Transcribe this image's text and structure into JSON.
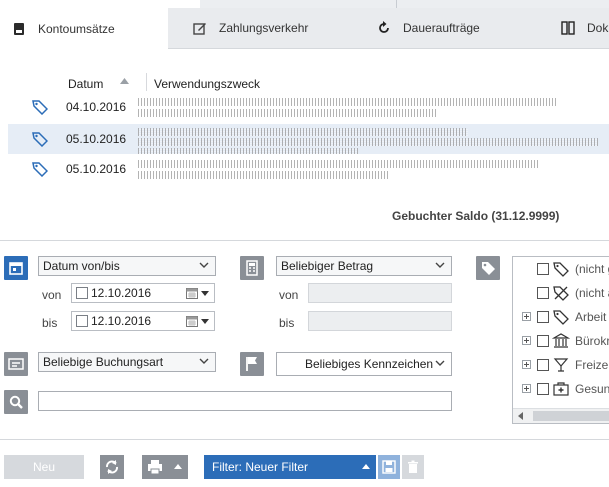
{
  "tabs": [
    {
      "label": "Kontoumsätze",
      "icon": "document-icon",
      "active": true
    },
    {
      "label": "Zahlungsverkehr",
      "icon": "edit-icon",
      "active": false
    },
    {
      "label": "Daueraufträge",
      "icon": "refresh-icon",
      "active": false
    },
    {
      "label": "Doku",
      "icon": "binder-icon",
      "active": false
    }
  ],
  "table": {
    "col_datum": "Datum",
    "col_verwendungszweck": "Verwendungszweck",
    "rows": [
      {
        "date": "04.10.2016",
        "selected": false
      },
      {
        "date": "05.10.2016",
        "selected": true
      },
      {
        "date": "05.10.2016",
        "selected": false
      }
    ]
  },
  "saldo": "Gebuchter Saldo (31.12.9999)",
  "filters": {
    "date_type": "Datum von/bis",
    "von_label": "von",
    "bis_label": "bis",
    "date_from": "12.10.2016",
    "date_to": "12.10.2016",
    "amount_type": "Beliebiger Betrag",
    "amount_von_label": "von",
    "amount_bis_label": "bis",
    "booking_type": "Beliebige Buchungsart",
    "marker": "Beliebiges Kennzeichen",
    "search_value": ""
  },
  "tree": [
    {
      "label": "(nicht g",
      "icon": "tag-icon",
      "expandable": false
    },
    {
      "label": "(nicht a",
      "icon": "tag-crossed-icon",
      "expandable": false
    },
    {
      "label": "Arbeit",
      "icon": "tag-icon",
      "expandable": true
    },
    {
      "label": "Bürokr",
      "icon": "bank-icon",
      "expandable": true
    },
    {
      "label": "Freizei",
      "icon": "cocktail-icon",
      "expandable": true
    },
    {
      "label": "Gesund",
      "icon": "medical-icon",
      "expandable": true
    }
  ],
  "bottom": {
    "new_label": "Neu",
    "filter_label": "Filter: Neuer Filter"
  },
  "colors": {
    "accent": "#2c6db8",
    "icon_bg": "#8a8f96",
    "selected_row": "#e6edf6",
    "disabled": "#d6d9dd"
  }
}
